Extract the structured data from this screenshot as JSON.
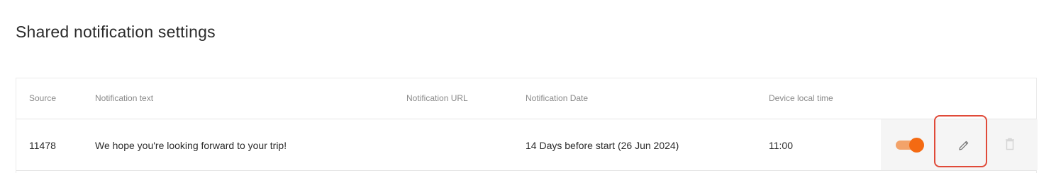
{
  "page": {
    "title": "Shared notification settings"
  },
  "table": {
    "columns": [
      "Source",
      "Notification text",
      "Notification URL",
      "Notification Date",
      "Device local time"
    ],
    "rows": [
      {
        "source": "11478",
        "text": "We hope you're looking forward to your trip!",
        "url": "",
        "date": "14 Days before start (26 Jun 2024)",
        "local_time": "11:00",
        "enabled": true
      }
    ]
  },
  "icons": {
    "edit": "pencil-icon",
    "delete": "trash-icon"
  },
  "colors": {
    "toggle_on": "#f46a12",
    "toggle_track": "#f3a36a",
    "highlight_border": "#e04a39",
    "action_cell_bg": "#f5f5f5"
  }
}
